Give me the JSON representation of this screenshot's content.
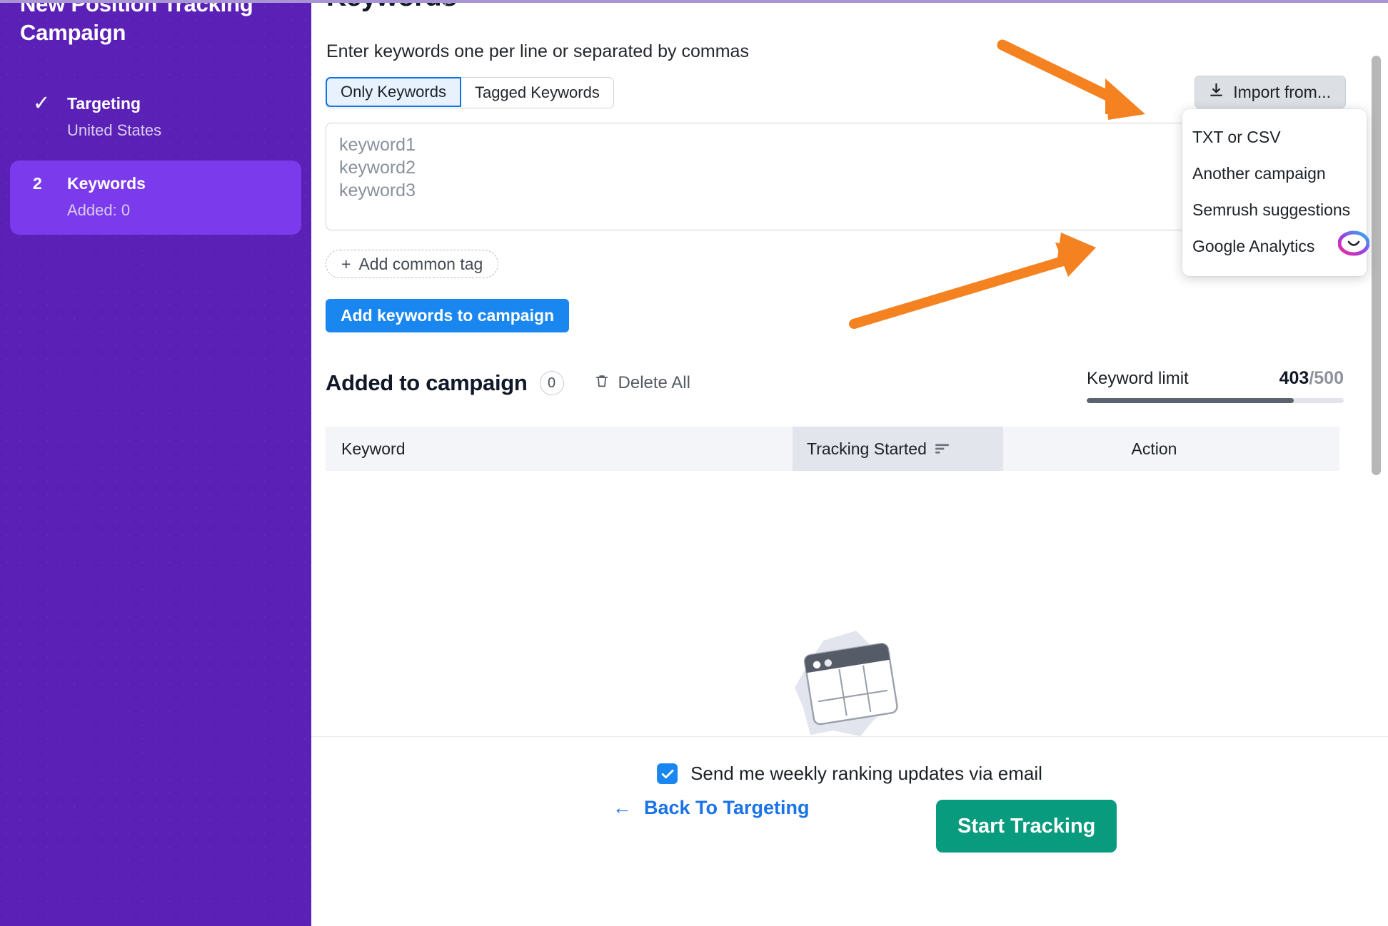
{
  "sidebar": {
    "campaign_title": "New Position Tracking\nCampaign",
    "steps": [
      {
        "marker": "✓",
        "name": "Targeting",
        "sub": "United States",
        "state": "done"
      },
      {
        "marker": "2",
        "name": "Keywords",
        "sub": "Added: 0",
        "state": "active"
      }
    ]
  },
  "main": {
    "page_title": "Keywords",
    "info_icon": "i",
    "helper_text": "Enter keywords one per line or separated by commas",
    "tabs": [
      {
        "label": "Only Keywords",
        "selected": true
      },
      {
        "label": "Tagged Keywords",
        "selected": false
      }
    ],
    "import_button": {
      "label": "Import from...",
      "icon": "download-icon"
    },
    "dropdown": {
      "items": [
        "TXT or CSV",
        "Another campaign",
        "Semrush suggestions",
        "Google Analytics"
      ]
    },
    "keywords_textarea": {
      "placeholder": "keyword1\nkeyword2\nkeyword3",
      "value": ""
    },
    "add_common_tag": {
      "plus": "+",
      "label": "Add common tag"
    },
    "add_keywords_button": "Add keywords to campaign",
    "added_section": {
      "title": "Added to campaign",
      "count": "0",
      "delete_all": "Delete All"
    },
    "keyword_limit": {
      "label": "Keyword limit",
      "used": "403",
      "separator": "/",
      "total": "500",
      "percent": 80.6
    },
    "table": {
      "columns": [
        "Keyword",
        "Tracking Started",
        "Action"
      ]
    }
  },
  "footer": {
    "weekly_updates_label": "Send me weekly ranking updates via email",
    "weekly_updates_checked": true,
    "back_link": "Back To Targeting",
    "back_arrow": "←",
    "start_button": "Start Tracking"
  },
  "colors": {
    "sidebar_purple": "#5b21b6",
    "sidebar_active": "#7c3aed",
    "primary_blue": "#1a87f0",
    "green": "#099b7d",
    "annotation_orange": "#f58220"
  }
}
